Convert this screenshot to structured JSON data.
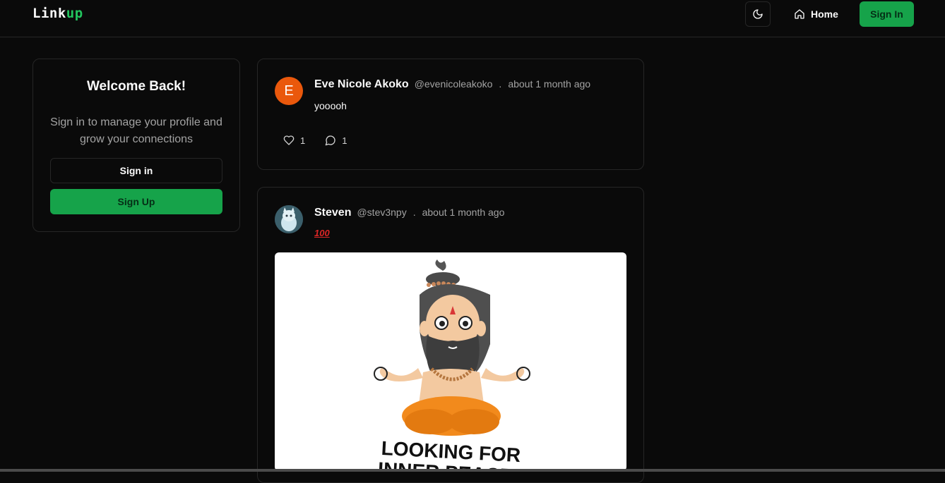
{
  "brand": {
    "part1": "Link",
    "part2": "up",
    "accent_color": "#22c55e"
  },
  "nav": {
    "theme_icon": "moon-icon",
    "home_label": "Home",
    "home_icon": "home-icon",
    "signin_label": "Sign In"
  },
  "welcome": {
    "title": "Welcome Back!",
    "subtitle": "Sign in to manage your profile and grow your connections",
    "signin_label": "Sign in",
    "signup_label": "Sign Up"
  },
  "posts": [
    {
      "avatar_letter": "E",
      "name": "Eve Nicole Akoko",
      "handle": "@evenicoleakoko",
      "separator": ".",
      "time": "about 1 month ago",
      "text": "yooooh",
      "likes": "1",
      "comments": "1"
    },
    {
      "name": "Steven",
      "handle": "@stev3npy",
      "separator": ".",
      "time": "about 1 month ago",
      "emoji_text": "100",
      "image_caption_line1": "LOOKING FOR",
      "image_caption_line2": "INNER PEACE.."
    }
  ],
  "colors": {
    "primary": "#16a34a",
    "background": "#0a0a0a",
    "border": "#262626"
  }
}
